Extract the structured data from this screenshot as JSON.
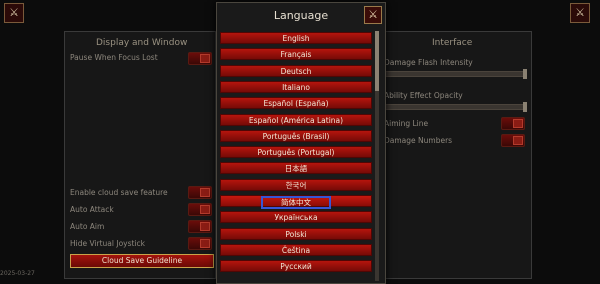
{
  "left_panel": {
    "title": "Display and Window",
    "options": [
      {
        "label": "Pause When Focus Lost"
      },
      {
        "label": "Enable cloud save feature"
      },
      {
        "label": "Auto Attack"
      },
      {
        "label": "Auto Aim"
      },
      {
        "label": "Hide Virtual Joystick"
      }
    ],
    "cloud_button": "Cloud Save Guideline"
  },
  "right_panel": {
    "title": "Interface",
    "options": [
      {
        "label": "Damage Flash Intensity"
      },
      {
        "label": "Ability Effect Opacity"
      },
      {
        "label": "Aiming Line"
      },
      {
        "label": "Damage Numbers"
      }
    ]
  },
  "date": "2025-03-27",
  "modal": {
    "title": "Language",
    "close_icon": "crossed-swords-icon",
    "languages": [
      "English",
      "Français",
      "Deutsch",
      "Italiano",
      "Español (España)",
      "Español (América Latina)",
      "Português (Brasil)",
      "Português (Portugal)",
      "日本語",
      "한국어",
      "简体中文",
      "Українська",
      "Polski",
      "Čeština",
      "Русский"
    ],
    "selected_index": 10
  }
}
